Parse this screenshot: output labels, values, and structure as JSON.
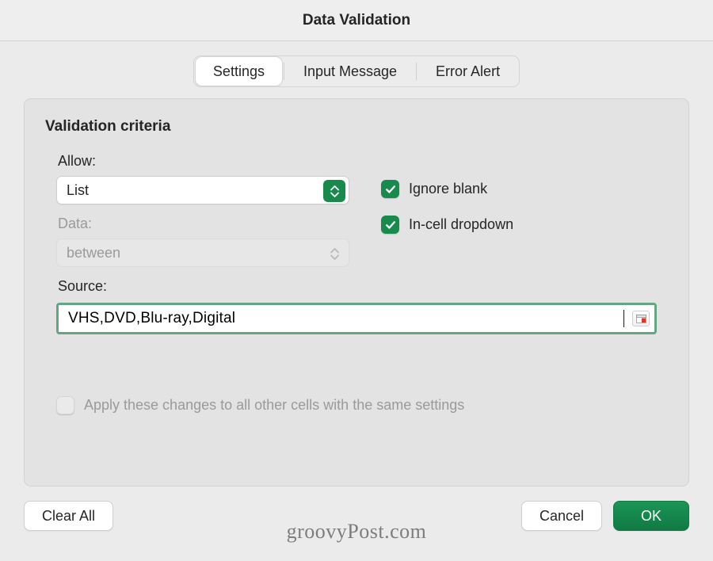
{
  "title": "Data Validation",
  "tabs": {
    "settings": "Settings",
    "input_message": "Input Message",
    "error_alert": "Error Alert"
  },
  "panel": {
    "heading": "Validation criteria",
    "allow_label": "Allow:",
    "allow_value": "List",
    "data_label": "Data:",
    "data_value": "between",
    "source_label": "Source:",
    "source_value": "VHS,DVD,Blu-ray,Digital",
    "ignore_blank_label": "Ignore blank",
    "incell_dropdown_label": "In-cell dropdown",
    "apply_all_label": "Apply these changes to all other cells with the same settings"
  },
  "footer": {
    "clear_all": "Clear All",
    "cancel": "Cancel",
    "ok": "OK"
  },
  "watermark": "groovyPost.com",
  "colors": {
    "accent": "#178a4c"
  }
}
